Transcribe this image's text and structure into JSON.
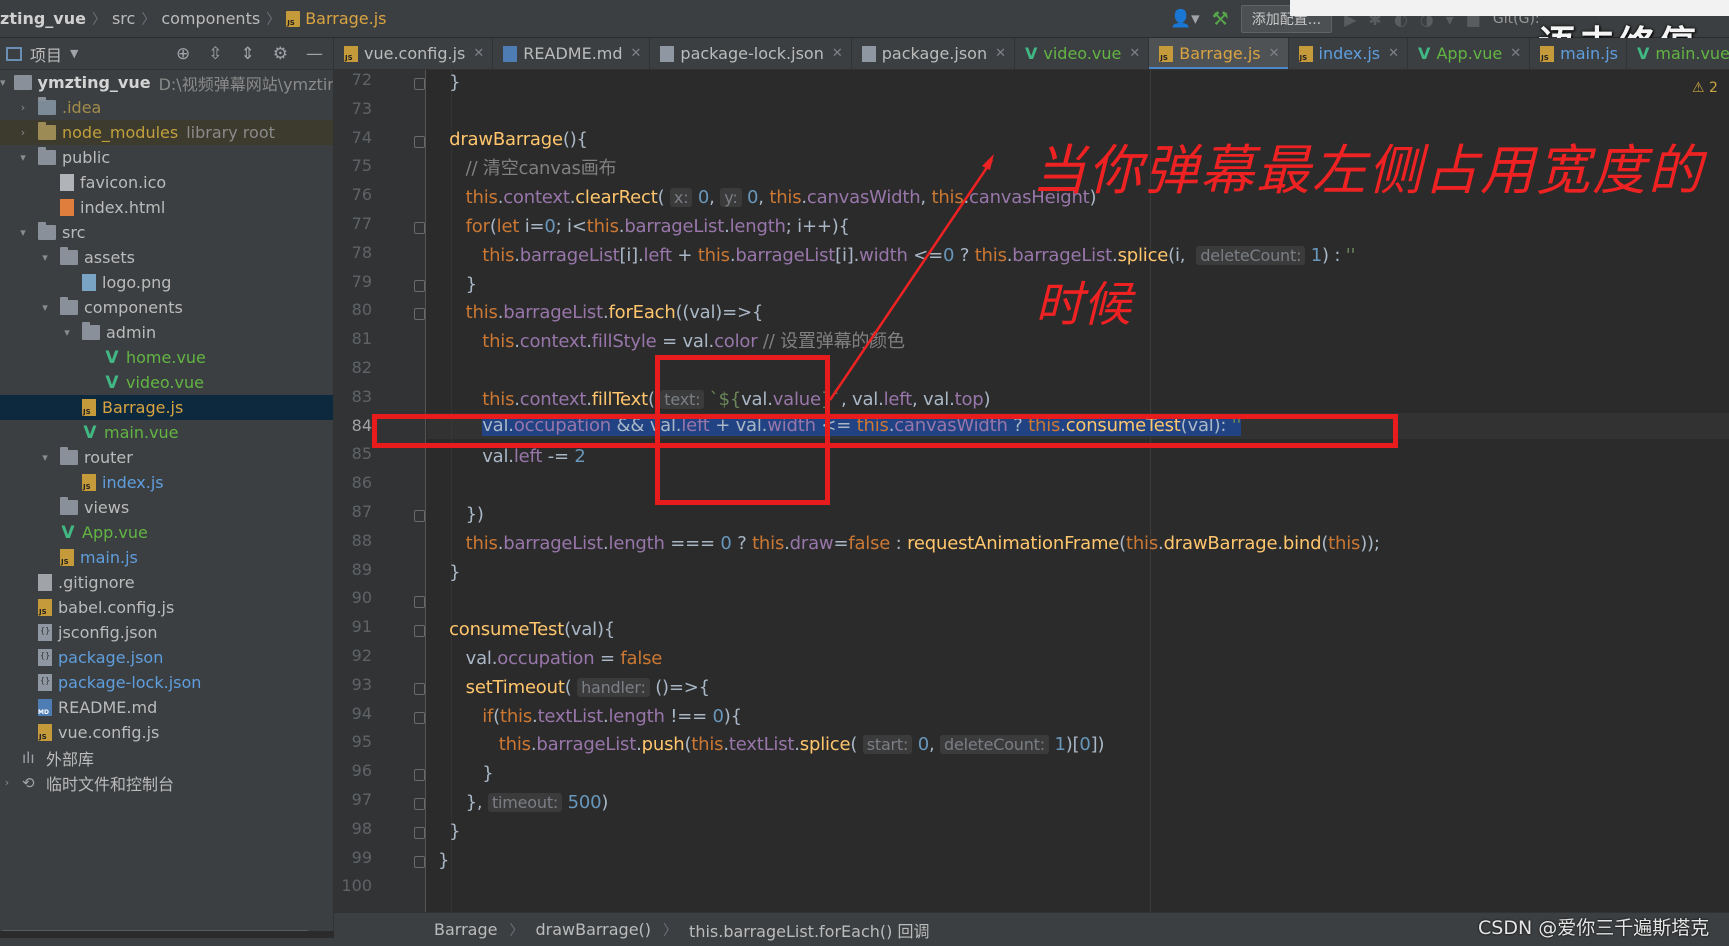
{
  "navbar": {
    "crumbs": [
      "zting_vue",
      "src",
      "components",
      "Barrage.js"
    ],
    "add_config": "添加配置...",
    "git_label": "Git(G):",
    "watermark": "语未终停"
  },
  "project_panel": {
    "title": "项目"
  },
  "tree": [
    {
      "label": "ymzting_vue",
      "path": "D:\\视频弹幕网站\\ymzting_v"
    },
    {
      "label": ".idea"
    },
    {
      "label": "node_modules",
      "extra": "library root"
    },
    {
      "label": "public"
    },
    {
      "label": "favicon.ico"
    },
    {
      "label": "index.html"
    },
    {
      "label": "src"
    },
    {
      "label": "assets"
    },
    {
      "label": "logo.png"
    },
    {
      "label": "components"
    },
    {
      "label": "admin"
    },
    {
      "label": "home.vue"
    },
    {
      "label": "video.vue"
    },
    {
      "label": "Barrage.js"
    },
    {
      "label": "main.vue"
    },
    {
      "label": "router"
    },
    {
      "label": "index.js"
    },
    {
      "label": "views"
    },
    {
      "label": "App.vue"
    },
    {
      "label": "main.js"
    },
    {
      "label": ".gitignore"
    },
    {
      "label": "babel.config.js"
    },
    {
      "label": "jsconfig.json"
    },
    {
      "label": "package.json"
    },
    {
      "label": "package-lock.json"
    },
    {
      "label": "README.md"
    },
    {
      "label": "vue.config.js"
    },
    {
      "label": "外部库"
    },
    {
      "label": "临时文件和控制台"
    }
  ],
  "tabs": [
    {
      "label": "vue.config.js"
    },
    {
      "label": "README.md"
    },
    {
      "label": "package-lock.json"
    },
    {
      "label": "package.json"
    },
    {
      "label": "video.vue"
    },
    {
      "label": "Barrage.js",
      "active": true
    },
    {
      "label": "index.js"
    },
    {
      "label": "App.vue"
    },
    {
      "label": "main.js"
    },
    {
      "label": "main.vue"
    }
  ],
  "editor": {
    "line_numbers": [
      "72",
      "73",
      "74",
      "75",
      "76",
      "77",
      "78",
      "79",
      "80",
      "81",
      "82",
      "83",
      "84",
      "85",
      "86",
      "87",
      "88",
      "89",
      "90",
      "91",
      "92",
      "93",
      "94",
      "95",
      "96",
      "97",
      "98",
      "99",
      "100"
    ],
    "current_line": "84",
    "warning_count": "2"
  },
  "annotation": {
    "line1": "当你弹幕最左侧占用宽度的",
    "line2": "时候",
    "color": "#ee2222"
  },
  "statusbar": {
    "crumbs": [
      "Barrage",
      "drawBarrage()",
      "this.barrageList.forEach() 回调"
    ],
    "credit": "CSDN @爱你三千遍斯塔克"
  },
  "colors": {
    "keyword": "#cc7832",
    "function": "#ffc66d",
    "property": "#9876aa",
    "number": "#6897bb",
    "string": "#6a8759",
    "comment": "#808080",
    "selection": "#214283"
  }
}
